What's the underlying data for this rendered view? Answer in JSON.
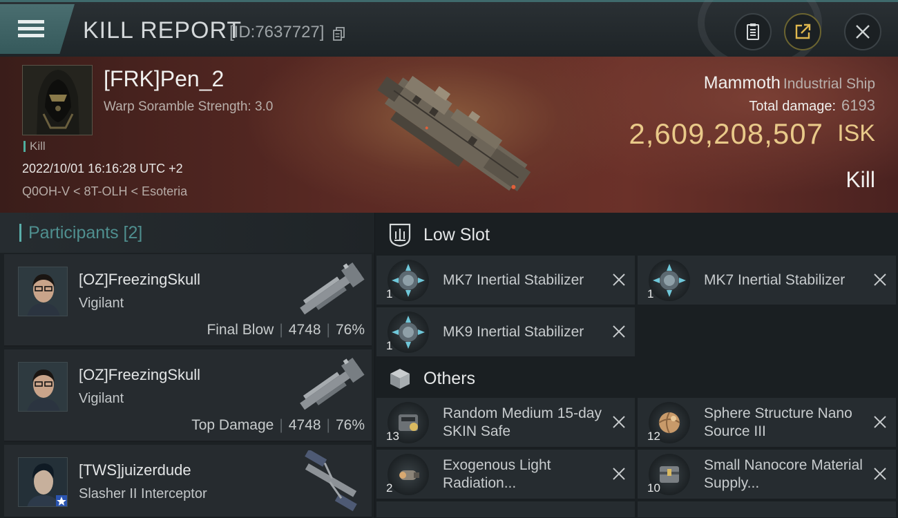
{
  "header": {
    "title": "KILL REPORT",
    "id_label": "[ID:7637727]"
  },
  "victim": {
    "name": "[FRK]Pen_2",
    "subtitle": "Warp Soramble Strength: 3.0",
    "tag": "Kill",
    "time": "2022/10/01 16:16:28 UTC +2",
    "location": "Q0OH-V < 8T-OLH < Esoteria"
  },
  "ship": {
    "name": "Mammoth",
    "class": "Industrial Ship",
    "total_damage_label": "Total damage:",
    "total_damage_value": "6193",
    "isk_value": "2,609,208,507",
    "isk_unit": "ISK",
    "result": "Kill"
  },
  "participants": {
    "header": "Participants [2]",
    "items": [
      {
        "name": "[OZ]FreezingSkull",
        "ship": "Vigilant",
        "role": "Final Blow",
        "damage": "4748",
        "percent": "76%"
      },
      {
        "name": "[OZ]FreezingSkull",
        "ship": "Vigilant",
        "role": "Top Damage",
        "damage": "4748",
        "percent": "76%"
      },
      {
        "name": "[TWS]juizerdude",
        "ship": "Slasher II Interceptor"
      }
    ]
  },
  "low_slot": {
    "title": "Low Slot",
    "items": [
      {
        "name": "MK7 Inertial Stabilizer",
        "qty": "1"
      },
      {
        "name": "MK7 Inertial Stabilizer",
        "qty": "1"
      },
      {
        "name": "MK9 Inertial Stabilizer",
        "qty": "1"
      }
    ]
  },
  "others": {
    "title": "Others",
    "items": [
      {
        "name": "Random Medium 15-day SKIN Safe",
        "qty": "13"
      },
      {
        "name": "Sphere Structure Nano Source III",
        "qty": "12"
      },
      {
        "name": "Exogenous Light Radiation...",
        "qty": "2"
      },
      {
        "name": "Small Nanocore Material Supply...",
        "qty": "10"
      }
    ]
  },
  "colors": {
    "accent": "#5aaeaa",
    "isk": "#e9c989",
    "banner": "#5b2a24"
  }
}
